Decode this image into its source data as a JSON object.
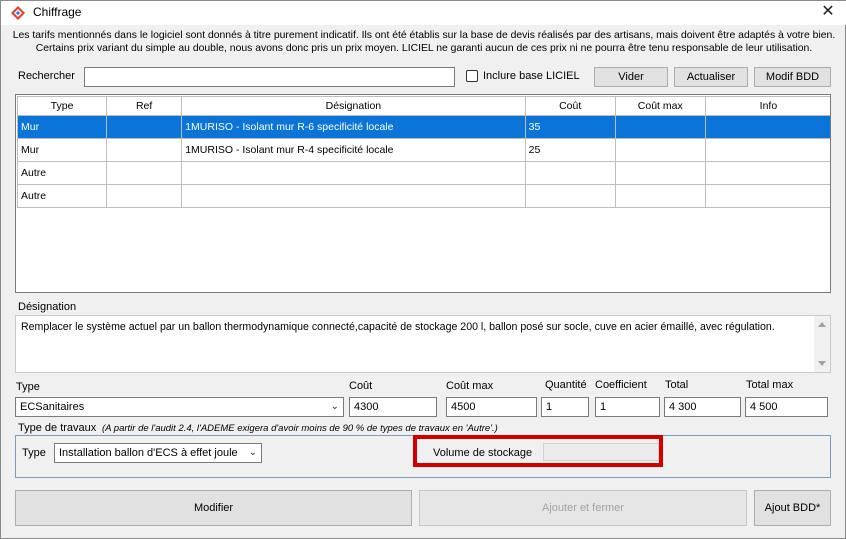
{
  "window": {
    "title": "Chiffrage",
    "close_symbol": "✕"
  },
  "notice": {
    "line1": "Les tarifs mentionnés dans le logiciel sont donnés à titre purement indicatif. Ils ont été établis sur la base de devis réalisés par des artisans, mais doivent être adaptés à votre bien.",
    "line2": "Certains prix variant du simple au double, nous avons donc pris un prix moyen. LICIEL ne garanti aucun de ces prix ni ne pourra être tenu responsable de leur utilisation."
  },
  "search": {
    "label": "Rechercher",
    "value": "",
    "checkbox_label": "Inclure base LICIEL",
    "checkbox_checked": false
  },
  "toolbar": {
    "vider": "Vider",
    "actualiser": "Actualiser",
    "modif_bdd": "Modif BDD"
  },
  "grid": {
    "headers": [
      "Type",
      "Ref",
      "Désignation",
      "Coût",
      "Coût max",
      "Info"
    ],
    "rows": [
      [
        "Mur",
        "",
        "1MURISO - Isolant mur R-6 specificité locale",
        "35",
        "",
        ""
      ],
      [
        "Mur",
        "",
        "1MURISO - Isolant mur R-4 specificité locale",
        "25",
        "",
        ""
      ],
      [
        "Autre",
        "",
        "",
        "",
        "",
        ""
      ],
      [
        "Autre",
        "",
        "",
        "",
        "",
        ""
      ]
    ],
    "selected_row": 0
  },
  "designation": {
    "label": "Désignation",
    "text": "Remplacer le système actuel par un ballon thermodynamique connecté,capacité de stockage 200 l, ballon posé sur socle, cuve en acier émaillé, avec régulation."
  },
  "fields": {
    "type_label": "Type",
    "type_value": "ECSanitaires",
    "cout_label": "Coût",
    "cout_value": "4300",
    "cout_max_label": "Coût max",
    "cout_max_value": "4500",
    "quantite_label": "Quantité",
    "quantite_value": "1",
    "coefficient_label": "Coefficient",
    "coefficient_value": "1",
    "total_label": "Total",
    "total_value": "4 300",
    "total_max_label": "Total max",
    "total_max_value": "4 500"
  },
  "travaux": {
    "label": "Type de travaux",
    "note": "(A partir de l'audit 2.4, l'ADEME exigera d'avoir moins de 90 % de types de travaux en 'Autre'.)",
    "type_label": "Type",
    "type_value": "Installation ballon d'ECS à effet joule",
    "volume_label": "Volume de stockage",
    "volume_value": ""
  },
  "buttons": {
    "modifier": "Modifier",
    "ajouter_fermer": "Ajouter et fermer",
    "ajout_bdd": "Ajout BDD*"
  },
  "colors": {
    "selection": "#0a74d9",
    "highlight_border": "#d40000",
    "groupbox_border": "#7a9cc0"
  }
}
